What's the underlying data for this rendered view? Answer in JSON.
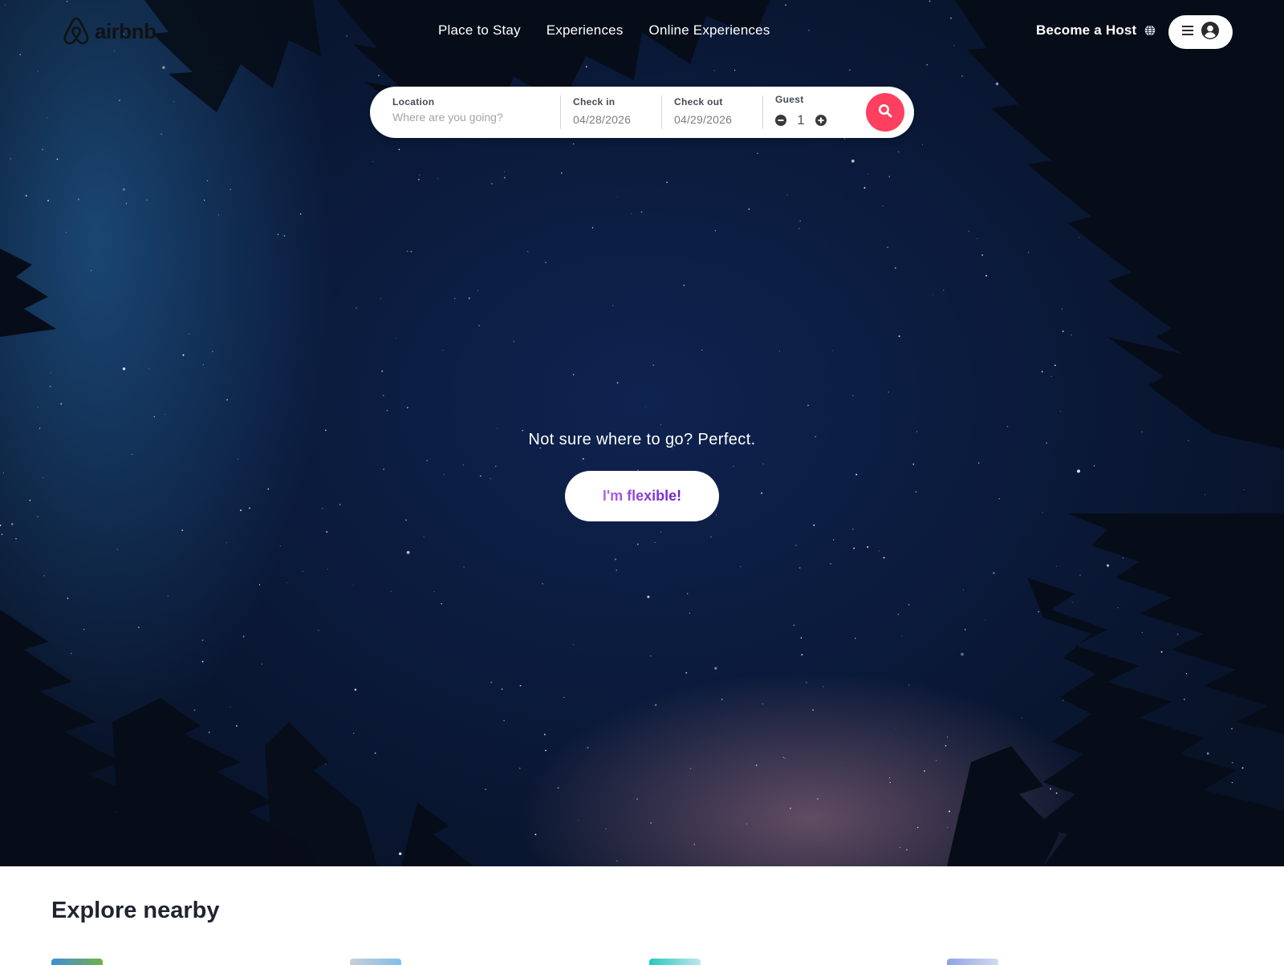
{
  "brand": {
    "logo_text": "airbnb"
  },
  "nav": {
    "links": [
      "Place to Stay",
      "Experiences",
      "Online Experiences"
    ],
    "become_host": "Become a Host"
  },
  "icons": {
    "globe": "globe-icon",
    "menu": "hamburger-icon",
    "user": "user-circle-icon",
    "search": "search-icon",
    "minus": "minus-circle-icon",
    "plus": "plus-circle-icon"
  },
  "search": {
    "location_label": "Location",
    "location_placeholder": "Where are you going?",
    "checkin_label": "Check in",
    "checkin_value": "04/28/2026",
    "checkout_label": "Check out",
    "checkout_value": "04/29/2026",
    "guest_label": "Guest",
    "guest_count": "1"
  },
  "hero": {
    "tagline": "Not sure where to go? Perfect.",
    "cta_label": "I'm flexible!"
  },
  "explore": {
    "title": "Explore nearby"
  },
  "colors": {
    "accent": "#fe3f5f",
    "cta_gradient_start": "#b56bd6",
    "cta_gradient_end": "#6b21c8",
    "sky": "#0a1938"
  }
}
